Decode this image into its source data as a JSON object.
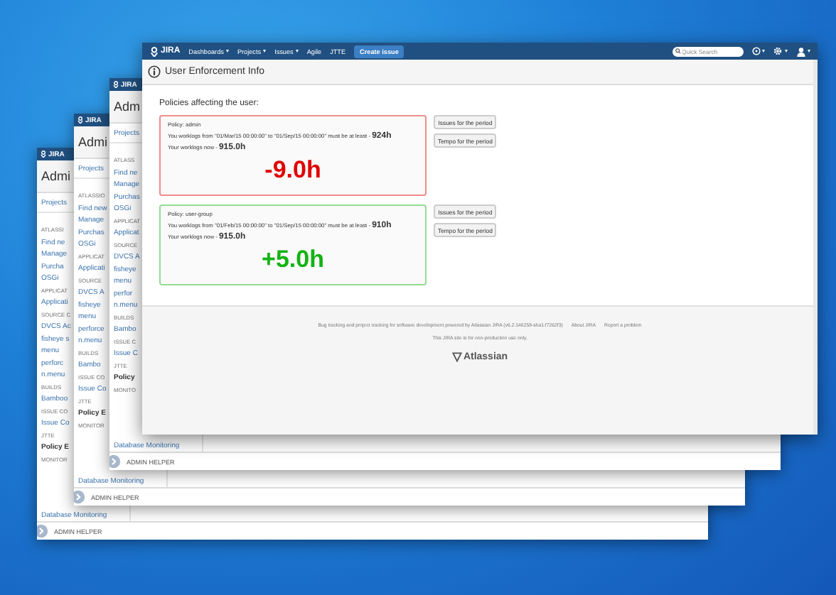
{
  "back_windows": [
    {
      "logo": "JIRA",
      "title": "Admi",
      "nav_link": "Projects",
      "items": [
        {
          "kind": "heading",
          "text": "ATLASSI"
        },
        {
          "kind": "link",
          "text": "Find ne"
        },
        {
          "kind": "link",
          "text": "Manage"
        },
        {
          "kind": "link",
          "text": "Purcha"
        },
        {
          "kind": "link",
          "text": "OSGi"
        },
        {
          "kind": "heading",
          "text": "APPLICAT"
        },
        {
          "kind": "link",
          "text": "Applicati"
        },
        {
          "kind": "heading",
          "text": "SOURCE C"
        },
        {
          "kind": "link",
          "text": "DVCS Ac"
        },
        {
          "kind": "link",
          "text": "fisheye s\nmenu"
        },
        {
          "kind": "link",
          "text": "perforc\nn.menu"
        },
        {
          "kind": "heading",
          "text": "BUILDS"
        },
        {
          "kind": "link",
          "text": "Bamboo"
        },
        {
          "kind": "heading",
          "text": "ISSUE CO"
        },
        {
          "kind": "link",
          "text": "Issue Co"
        },
        {
          "kind": "heading",
          "text": "JTTE"
        },
        {
          "kind": "current",
          "text": "Policy E"
        },
        {
          "kind": "heading",
          "text": "MONITOR"
        },
        {
          "kind": "link",
          "text": "Database Monitoring"
        }
      ],
      "footer": "ADMIN HELPER"
    },
    {
      "logo": "JIRA",
      "title": "Admi",
      "nav_link": "Projects",
      "items": [
        {
          "kind": "heading",
          "text": "ATLASSIO"
        },
        {
          "kind": "link",
          "text": "Find new"
        },
        {
          "kind": "link",
          "text": "Manage"
        },
        {
          "kind": "link",
          "text": "Purchas"
        },
        {
          "kind": "link",
          "text": "OSGi"
        },
        {
          "kind": "heading",
          "text": "APPLICAT"
        },
        {
          "kind": "link",
          "text": "Applicati"
        },
        {
          "kind": "heading",
          "text": "SOURCE"
        },
        {
          "kind": "link",
          "text": "DVCS A"
        },
        {
          "kind": "link",
          "text": "fisheye\nmenu"
        },
        {
          "kind": "link",
          "text": "perforce\nn.menu"
        },
        {
          "kind": "heading",
          "text": "BUILDS"
        },
        {
          "kind": "link",
          "text": "Bambo"
        },
        {
          "kind": "heading",
          "text": "ISSUE CO"
        },
        {
          "kind": "link",
          "text": "Issue Co"
        },
        {
          "kind": "heading",
          "text": "JTTE"
        },
        {
          "kind": "current",
          "text": "Policy E"
        },
        {
          "kind": "heading",
          "text": "MONITOR"
        },
        {
          "kind": "link",
          "text": "Database Monitoring"
        }
      ],
      "footer": "ADMIN HELPER"
    },
    {
      "logo": "JIRA",
      "title": "Adm",
      "nav_link": "Projects",
      "items": [
        {
          "kind": "heading",
          "text": "ATLASS"
        },
        {
          "kind": "link",
          "text": "Find ne"
        },
        {
          "kind": "link",
          "text": "Manage"
        },
        {
          "kind": "link",
          "text": "Purchas"
        },
        {
          "kind": "link",
          "text": "OSGi"
        },
        {
          "kind": "heading",
          "text": "APPLICAT"
        },
        {
          "kind": "link",
          "text": "Applicat"
        },
        {
          "kind": "heading",
          "text": "SOURCE"
        },
        {
          "kind": "link",
          "text": "DVCS A"
        },
        {
          "kind": "link",
          "text": "fisheye\nmenu"
        },
        {
          "kind": "link",
          "text": "perfor\nn.menu"
        },
        {
          "kind": "heading",
          "text": "BUILDS"
        },
        {
          "kind": "link",
          "text": "Bambo"
        },
        {
          "kind": "heading",
          "text": "ISSUE C"
        },
        {
          "kind": "link",
          "text": "Issue C"
        },
        {
          "kind": "heading",
          "text": "JTTE"
        },
        {
          "kind": "current",
          "text": "Policy"
        },
        {
          "kind": "heading",
          "text": "MONITO"
        },
        {
          "kind": "link",
          "text": "Database Monitoring"
        }
      ],
      "footer": "ADMIN HELPER"
    }
  ],
  "window": {
    "logo": "JIRA",
    "nav": [
      {
        "label": "Dashboards",
        "dropdown": true
      },
      {
        "label": "Projects",
        "dropdown": true
      },
      {
        "label": "Issues",
        "dropdown": true
      },
      {
        "label": "Agile",
        "dropdown": false
      },
      {
        "label": "JTTE",
        "dropdown": false
      }
    ],
    "create_button": "Create issue",
    "search": {
      "placeholder": "Quick Search"
    },
    "page_title": "User Enforcement Info",
    "section_title": "Policies affecting the user:",
    "policies": [
      {
        "name": "Policy: admin",
        "requirement": "You worklogs from \"01/Mar/15 00:00:00\" to \"01/Sep/15 00:00:00\" must be at least - **924h**",
        "current": "Your worklogs now - **915.0h**",
        "result": "-9.0h",
        "color": "#e00000",
        "buttons": [
          "Issues for the period",
          "Tempo for the period"
        ]
      },
      {
        "name": "Policy: user-group",
        "requirement": "You worklogs from \"01/Feb/15 00:00:00\" to \"01/Sep/15 00:00:00\" must be at least - **910h**",
        "current": "Your worklogs now - **915.0h**",
        "result": "+5.0h",
        "color": "#14b214",
        "buttons": [
          "Issues for the period",
          "Tempo for the period"
        ]
      }
    ],
    "footer": {
      "text": "Bug tracking and project tracking for software development powered by Atlassian JIRA (v6.2.1#6258-sha1:f7262f3)",
      "links": [
        "About JIRA",
        "Report a problem"
      ],
      "notice": "This JIRA site is for non-production use only.",
      "brand": "Atlassian"
    }
  }
}
